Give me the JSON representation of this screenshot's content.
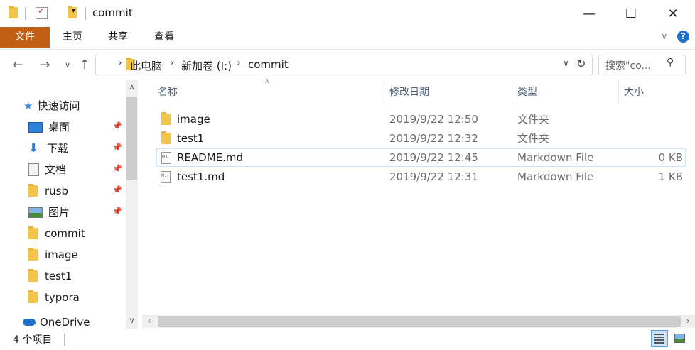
{
  "window": {
    "title": "commit",
    "minimize": "—",
    "maximize": "☐",
    "close": "✕"
  },
  "ribbon": {
    "tabs": [
      "文件",
      "主页",
      "共享",
      "查看"
    ],
    "collapse": "∨",
    "help": "?"
  },
  "nav": {
    "back": "←",
    "forward": "→",
    "recent": "∨",
    "up": "↑",
    "breadcrumbs": [
      "此电脑",
      "新加卷 (I:)",
      "commit"
    ],
    "search_placeholder": "搜索\"co..."
  },
  "sidebar": {
    "quick_access": "快速访问",
    "items": [
      {
        "label": "桌面",
        "icon": "desktop-icon",
        "pinned": true
      },
      {
        "label": "下载",
        "icon": "download-icon",
        "pinned": true
      },
      {
        "label": "文档",
        "icon": "document-icon",
        "pinned": true
      },
      {
        "label": "rusb",
        "icon": "folder-icon",
        "pinned": true
      },
      {
        "label": "图片",
        "icon": "pictures-icon",
        "pinned": true
      },
      {
        "label": "commit",
        "icon": "folder-icon",
        "pinned": false
      },
      {
        "label": "image",
        "icon": "folder-icon",
        "pinned": false
      },
      {
        "label": "test1",
        "icon": "folder-icon",
        "pinned": false
      },
      {
        "label": "typora",
        "icon": "folder-icon",
        "pinned": false
      }
    ],
    "onedrive": "OneDrive"
  },
  "columns": {
    "name": "名称",
    "modified": "修改日期",
    "type": "类型",
    "size": "大小"
  },
  "files": [
    {
      "name": "image",
      "modified": "2019/9/22 12:50",
      "type": "文件夹",
      "size": "",
      "icon": "folder-icon"
    },
    {
      "name": "test1",
      "modified": "2019/9/22 12:32",
      "type": "文件夹",
      "size": "",
      "icon": "folder-icon"
    },
    {
      "name": "README.md",
      "modified": "2019/9/22 12:45",
      "type": "Markdown File",
      "size": "0 KB",
      "icon": "markdown-file-icon"
    },
    {
      "name": "test1.md",
      "modified": "2019/9/22 12:31",
      "type": "Markdown File",
      "size": "1 KB",
      "icon": "markdown-file-icon"
    }
  ],
  "status": {
    "item_count": "4 个项目"
  }
}
